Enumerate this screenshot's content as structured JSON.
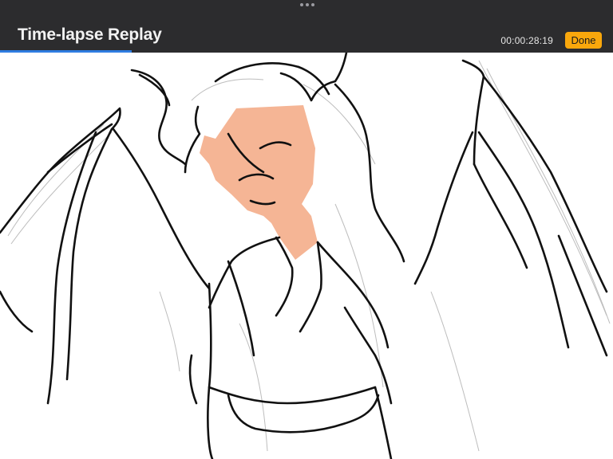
{
  "header": {
    "title": "Time-lapse Replay",
    "timestamp": "00:00:28:19",
    "done_label": "Done"
  },
  "playback": {
    "progress": 0.215
  },
  "colors": {
    "header_bg": "#2c2c2e",
    "accent_done": "#f9a70c",
    "progress_fill": "#2f7de1",
    "skin_fill": "#f5b595"
  },
  "icons": {
    "handle": "more-dots-icon"
  }
}
